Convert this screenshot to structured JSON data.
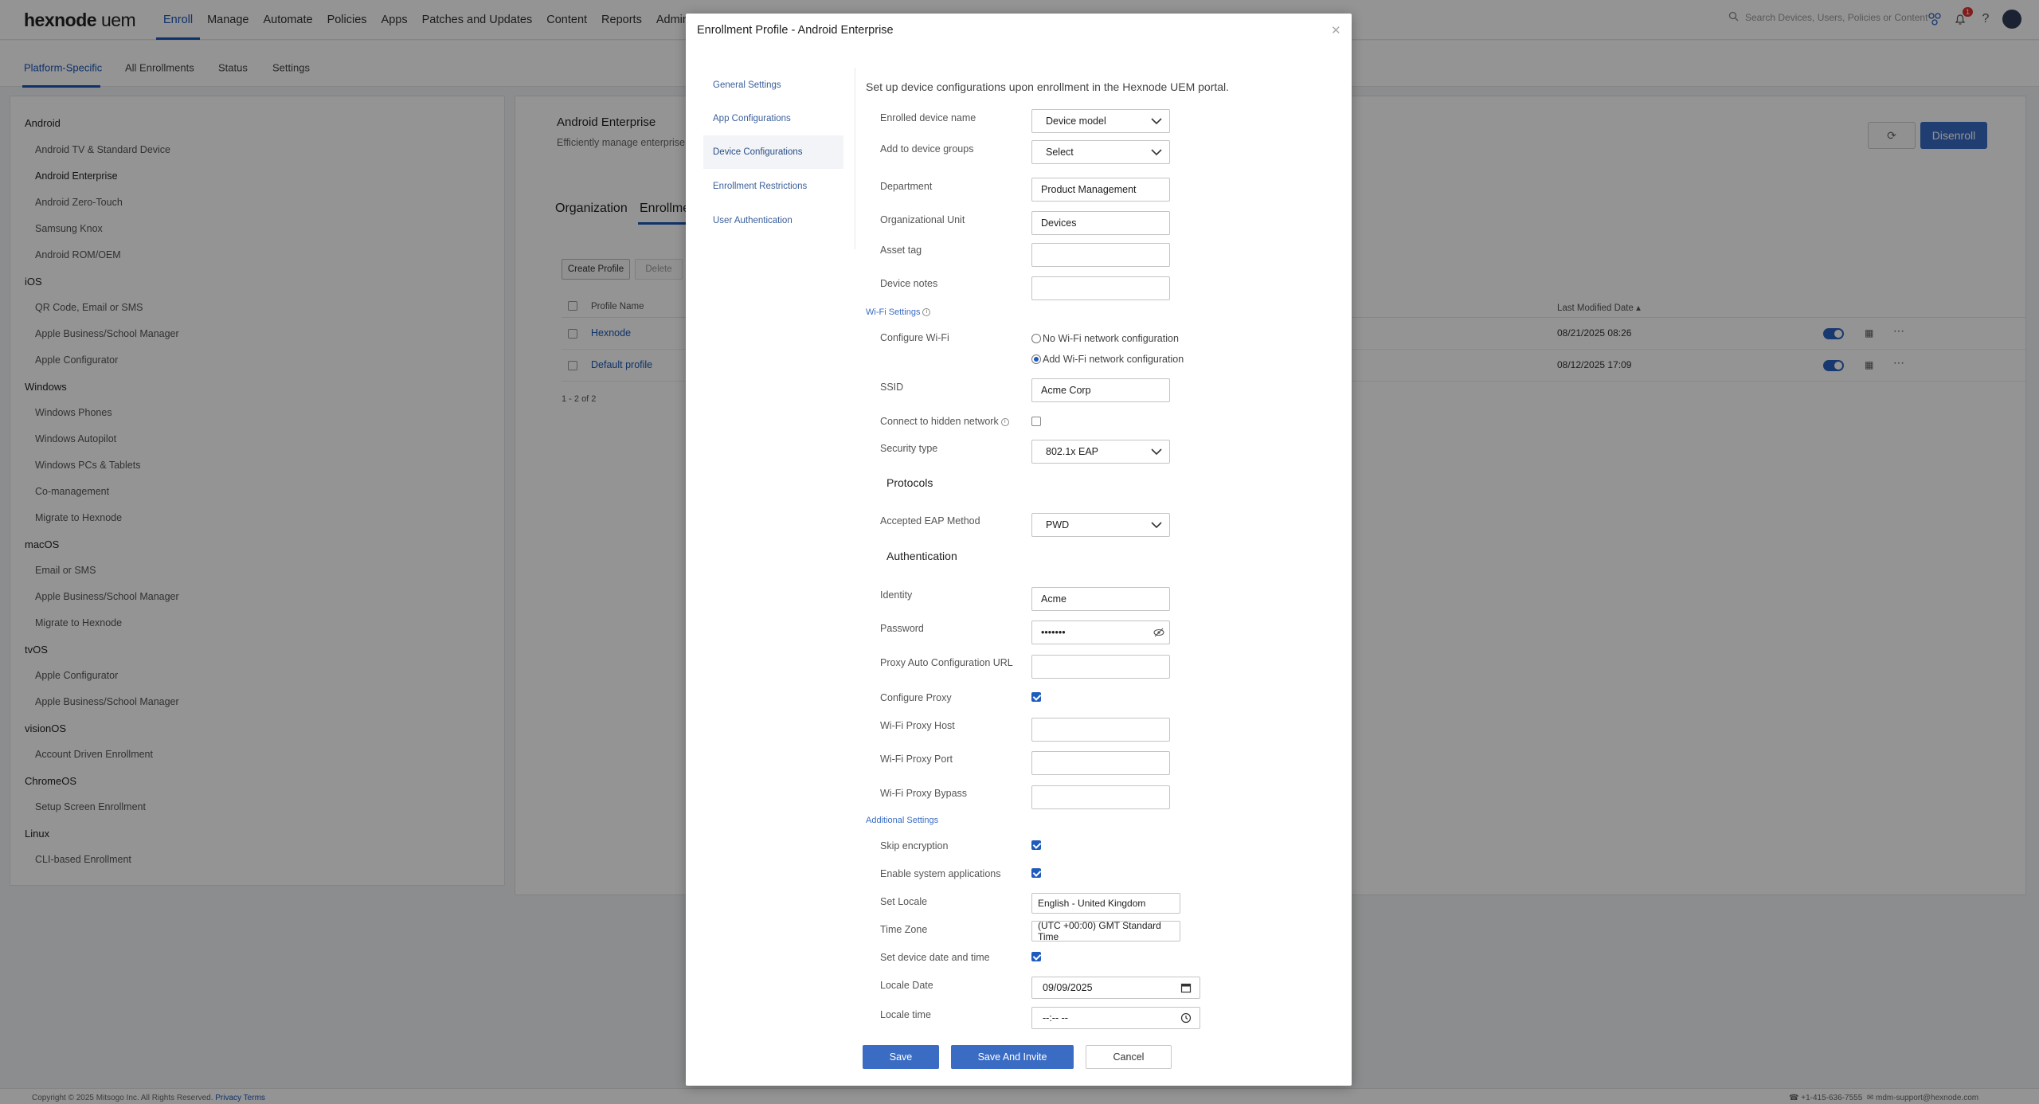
{
  "app": {
    "logo_brand": "hexnode",
    "logo_product": "uem",
    "nav": [
      "Enroll",
      "Manage",
      "Automate",
      "Policies",
      "Apps",
      "Patches and Updates",
      "Content",
      "Reports",
      "Admin"
    ],
    "search_placeholder": "Search Devices, Users, Policies or Content",
    "notification_count": "1"
  },
  "subtabs": [
    "Platform-Specific",
    "All Enrollments",
    "Status",
    "Settings"
  ],
  "sidebar": {
    "groups": [
      {
        "label": "Android",
        "items": [
          "Android TV & Standard Device",
          "Android Enterprise",
          "Android Zero-Touch",
          "Samsung Knox",
          "Android ROM/OEM"
        ]
      },
      {
        "label": "iOS",
        "items": [
          "QR Code, Email or SMS",
          "Apple Business/School Manager",
          "Apple Configurator"
        ]
      },
      {
        "label": "Windows",
        "items": [
          "Windows Phones",
          "Windows Autopilot",
          "Windows PCs & Tablets",
          "Co-management",
          "Migrate to Hexnode"
        ]
      },
      {
        "label": "macOS",
        "items": [
          "Email or SMS",
          "Apple Business/School Manager",
          "Migrate to Hexnode"
        ]
      },
      {
        "label": "tvOS",
        "items": [
          "Apple Configurator",
          "Apple Business/School Manager"
        ]
      },
      {
        "label": "visionOS",
        "items": [
          "Account Driven Enrollment"
        ]
      },
      {
        "label": "ChromeOS",
        "items": [
          "Setup Screen Enrollment"
        ]
      },
      {
        "label": "Linux",
        "items": [
          "CLI-based Enrollment"
        ]
      }
    ]
  },
  "main": {
    "title": "Android Enterprise",
    "description": "Efficiently manage enterprise d",
    "disenroll_label": "Disenroll",
    "tabs": [
      "Organization",
      "Enrollme"
    ],
    "create_profile_label": "Create Profile",
    "delete_label": "Delete",
    "col_profile_name": "Profile Name",
    "col_last_modified": "Last Modified Date",
    "rows": [
      {
        "name": "Hexnode",
        "date": "08/21/2025 08:26"
      },
      {
        "name": "Default profile",
        "date": "08/12/2025 17:09"
      }
    ],
    "pager": "1 - 2 of 2"
  },
  "footer": {
    "copyright": "Copyright © 2025 Mitsogo Inc. All Rights Reserved.",
    "privacy": "Privacy",
    "terms": "Terms",
    "phone": "+1-415-636-7555",
    "email": "mdm-support@hexnode.com"
  },
  "modal": {
    "title": "Enrollment Profile - Android Enterprise",
    "nav": [
      "General Settings",
      "App Configurations",
      "Device Configurations",
      "Enrollment Restrictions",
      "User Authentication"
    ],
    "intro": "Set up device configurations upon enrollment in the Hexnode UEM portal.",
    "enrolled_device_name": {
      "label": "Enrolled device name",
      "value": "Device model"
    },
    "device_groups": {
      "label": "Add to device groups",
      "value": "Select"
    },
    "department": {
      "label": "Department",
      "value": "Product Management"
    },
    "org_unit": {
      "label": "Organizational Unit",
      "value": "Devices"
    },
    "asset_tag": {
      "label": "Asset tag",
      "value": ""
    },
    "device_notes": {
      "label": "Device notes",
      "value": ""
    },
    "wifi_section": "Wi-Fi Settings",
    "configure_wifi": {
      "label": "Configure Wi-Fi",
      "option_none": "No Wi-Fi network configuration",
      "option_add": "Add Wi-Fi network configuration"
    },
    "ssid": {
      "label": "SSID",
      "value": "Acme Corp"
    },
    "hidden_network": {
      "label": "Connect to hidden network"
    },
    "security_type": {
      "label": "Security type",
      "value": "802.1x EAP"
    },
    "protocols_heading": "Protocols",
    "eap_method": {
      "label": "Accepted EAP Method",
      "value": "PWD"
    },
    "auth_heading": "Authentication",
    "identity": {
      "label": "Identity",
      "value": "Acme"
    },
    "password": {
      "label": "Password",
      "value": "•••••••"
    },
    "proxy_pac": {
      "label": "Proxy Auto Configuration URL",
      "value": ""
    },
    "configure_proxy": {
      "label": "Configure Proxy"
    },
    "proxy_host": {
      "label": "Wi-Fi Proxy Host",
      "value": ""
    },
    "proxy_port": {
      "label": "Wi-Fi Proxy Port",
      "value": ""
    },
    "proxy_bypass": {
      "label": "Wi-Fi Proxy Bypass",
      "value": ""
    },
    "additional_section": "Additional Settings",
    "skip_encryption": {
      "label": "Skip encryption"
    },
    "system_apps": {
      "label": "Enable system applications"
    },
    "locale": {
      "label": "Set Locale",
      "value": "English - United Kingdom"
    },
    "timezone": {
      "label": "Time Zone",
      "value": "(UTC +00:00) GMT Standard Time"
    },
    "set_datetime": {
      "label": "Set device date and time"
    },
    "locale_date": {
      "label": "Locale Date",
      "value": "09/09/2025"
    },
    "locale_time": {
      "label": "Locale time",
      "value": "--:-- --"
    },
    "save_label": "Save",
    "save_invite_label": "Save And Invite",
    "cancel_label": "Cancel"
  }
}
